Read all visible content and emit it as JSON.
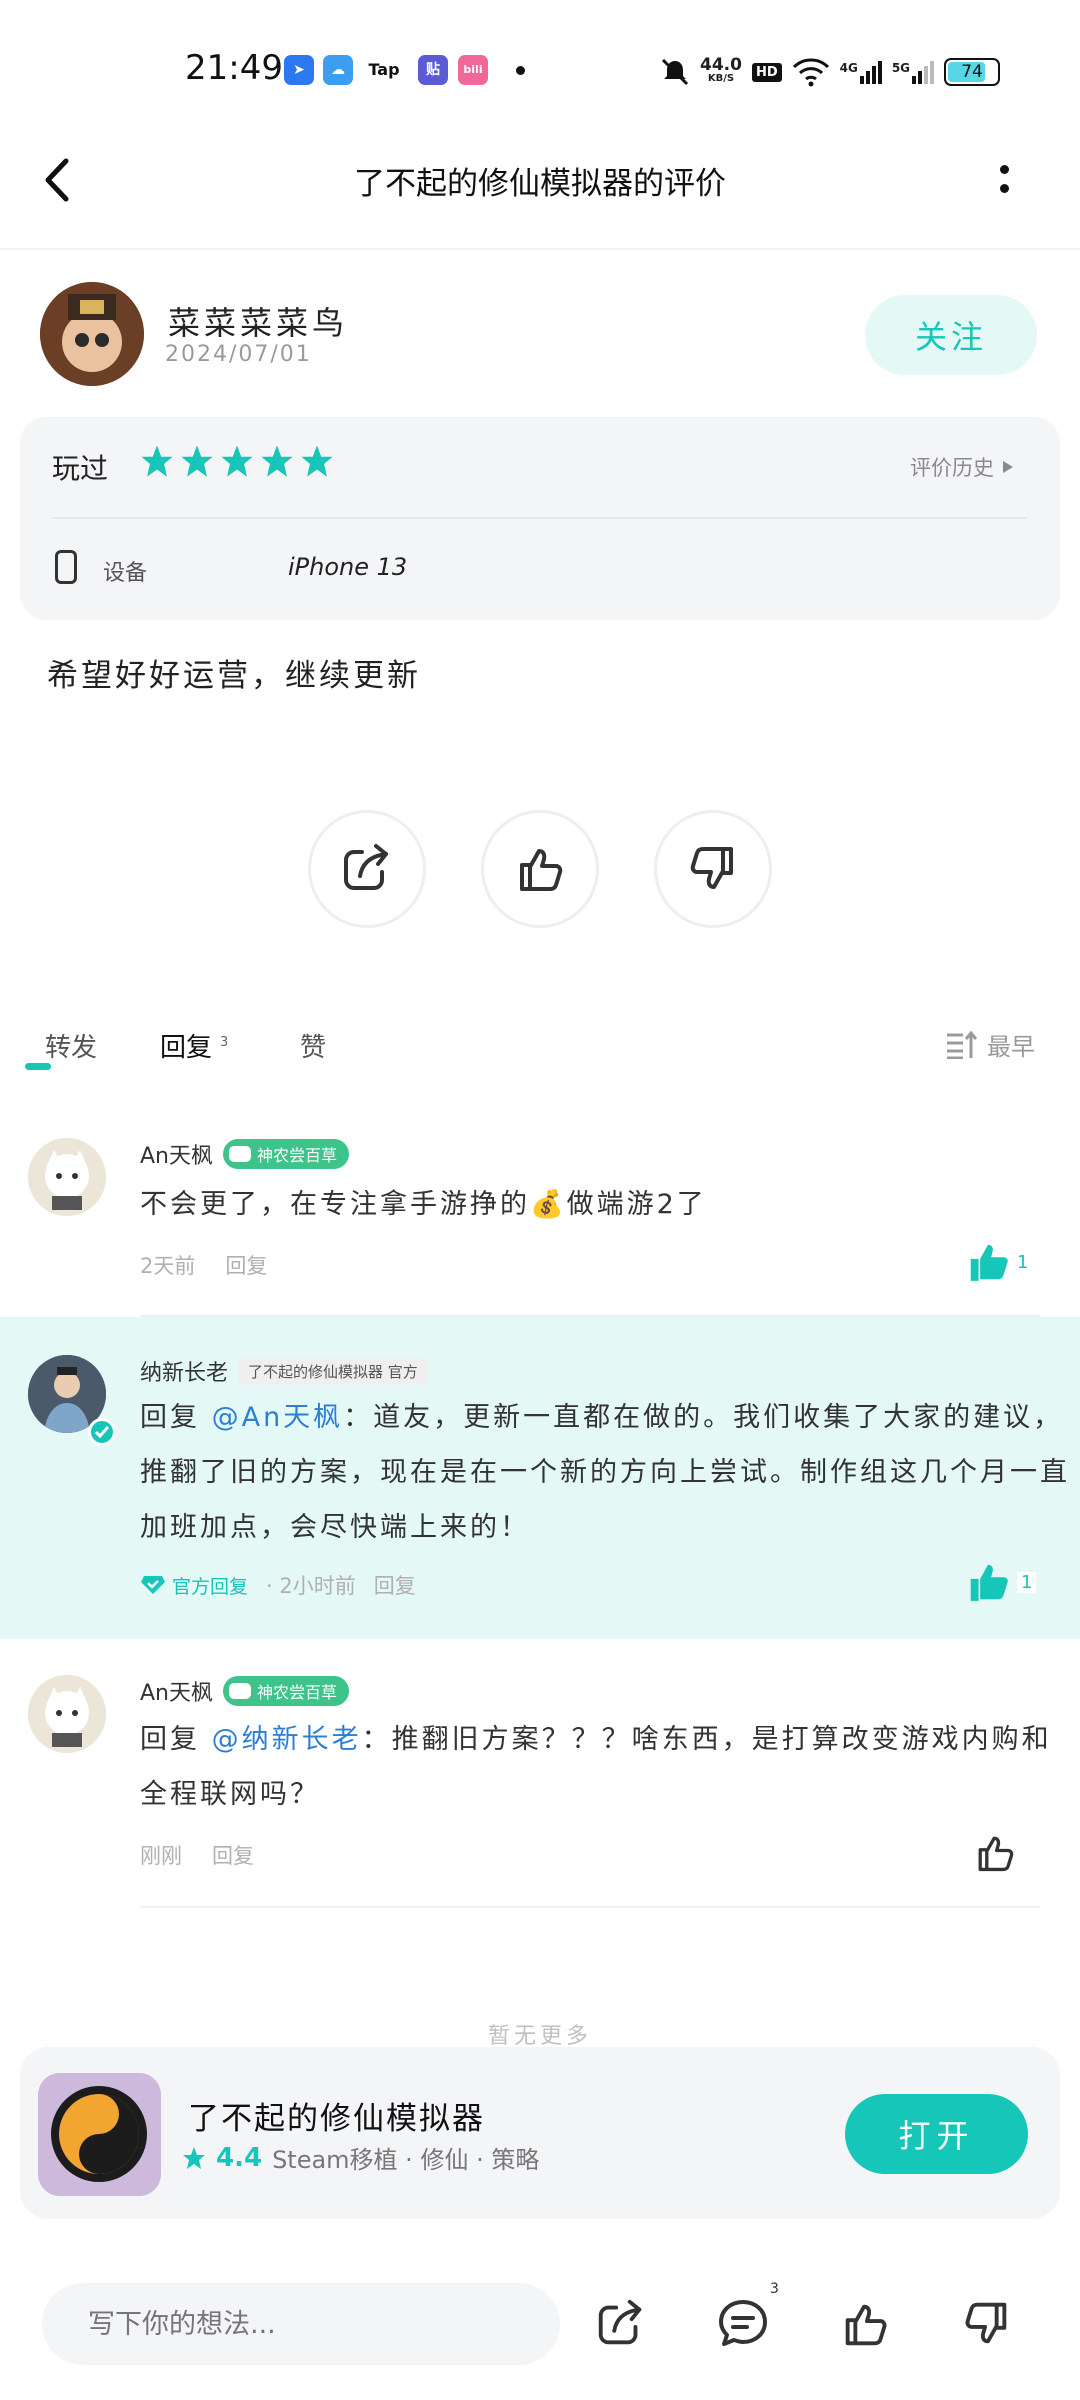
{
  "status_bar": {
    "time": "21:49",
    "app_icons": [
      {
        "name": "app-blue-arrow",
        "color": "#2b78f0",
        "glyph": "➤"
      },
      {
        "name": "app-weather",
        "color": "#3b9ef0",
        "glyph": "☁"
      },
      {
        "name": "app-tap",
        "color": "#ffffff",
        "glyph": "Tap"
      },
      {
        "name": "app-tieba",
        "color": "#5b5bd6",
        "glyph": "贴"
      },
      {
        "name": "app-bilibili",
        "color": "#f0679a",
        "glyph": "bili"
      }
    ],
    "net_speed": "44.0",
    "net_unit": "KB/S",
    "hd": "HD",
    "net_4g": "4G",
    "net_5g": "5G",
    "battery": "74"
  },
  "header": {
    "title": "了不起的修仙模拟器的评价"
  },
  "author": {
    "name": "菜菜菜菜鸟",
    "date": "2024/07/01",
    "follow_label": "关注"
  },
  "rating": {
    "played_label": "玩过",
    "stars": 5,
    "history_label": "评价历史",
    "device_label": "设备",
    "device_value": "iPhone 13"
  },
  "review": {
    "text": "希望好好运营，继续更新"
  },
  "tabs": {
    "repost": "转发",
    "reply": "回复",
    "reply_count": "3",
    "like": "赞",
    "sort": "最早"
  },
  "comments": [
    {
      "name": "An天枫",
      "badge": "神农尝百草",
      "text": "不会更了，在专注拿手游挣的💰做端游2了",
      "time": "2天前",
      "reply_label": "回复",
      "likes": "1"
    },
    {
      "name": "纳新长老",
      "tag": "了不起的修仙模拟器 官方",
      "reply_prefix": "回复",
      "mention": "@An天枫",
      "text": "：道友，更新一直都在做的。我们收集了大家的建议，推翻了旧的方案，现在是在一个新的方向上尝试。制作组这几个月一直加班加点，会尽快端上来的！",
      "official_label": "官方回复",
      "time": "· 2小时前",
      "reply_label": "回复",
      "likes": "1"
    },
    {
      "name": "An天枫",
      "badge": "神农尝百草",
      "reply_prefix": "回复",
      "mention": "@纳新长老",
      "text": "：推翻旧方案？？？啥东西，是打算改变游戏内购和全程联网吗？",
      "time": "刚刚",
      "reply_label": "回复"
    }
  ],
  "load_more": "暂无更多",
  "game": {
    "name": "了不起的修仙模拟器",
    "score": "4.4",
    "tags": "Steam移植 · 修仙 · 策略",
    "open_label": "打开"
  },
  "bottom_bar": {
    "input_placeholder": "写下你的想法...",
    "reply_count": "3"
  },
  "colors": {
    "accent": "#16c6b8",
    "official_bg": "#e4f8f6",
    "badge_green": "#3ec48b",
    "mention_blue": "#2d7fd3"
  },
  "icons": [
    "back-icon",
    "more-icon",
    "star-icon",
    "play-triangle-icon",
    "phone-icon",
    "share-icon",
    "thumbs-up-icon",
    "thumbs-down-icon",
    "sort-icon",
    "comment-icon",
    "verified-icon",
    "diamond-icon"
  ]
}
